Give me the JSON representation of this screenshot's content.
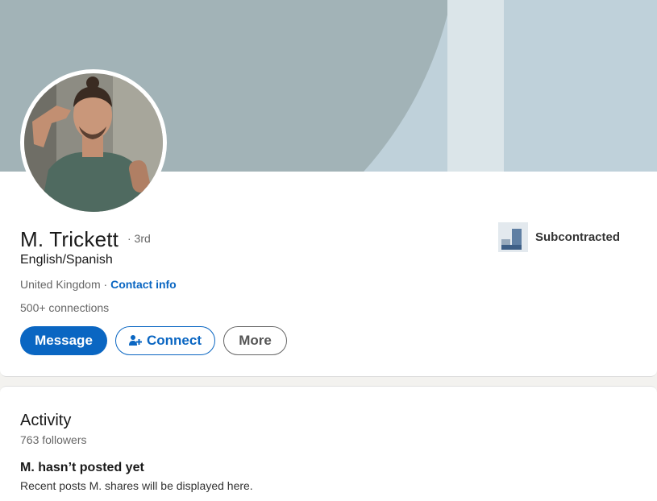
{
  "profile": {
    "name": "M. Trickett",
    "degree": "· 3rd",
    "headline": "English/Spanish",
    "location": "United Kingdom",
    "location_separator": " · ",
    "contact_info_label": "Contact info",
    "connections": "500+ connections",
    "company": {
      "name": "Subcontracted",
      "logo_icon": "company-logo-icon"
    },
    "buttons": {
      "message": "Message",
      "connect": "Connect",
      "more": "More"
    },
    "colors": {
      "accent": "#0a66c2",
      "banner": "#bfd1da",
      "banner_arc": "#a2b3b7"
    }
  },
  "activity": {
    "title": "Activity",
    "followers": "763 followers",
    "empty_title": "M. hasn’t posted yet",
    "empty_subtitle": "Recent posts M. shares will be displayed here."
  }
}
